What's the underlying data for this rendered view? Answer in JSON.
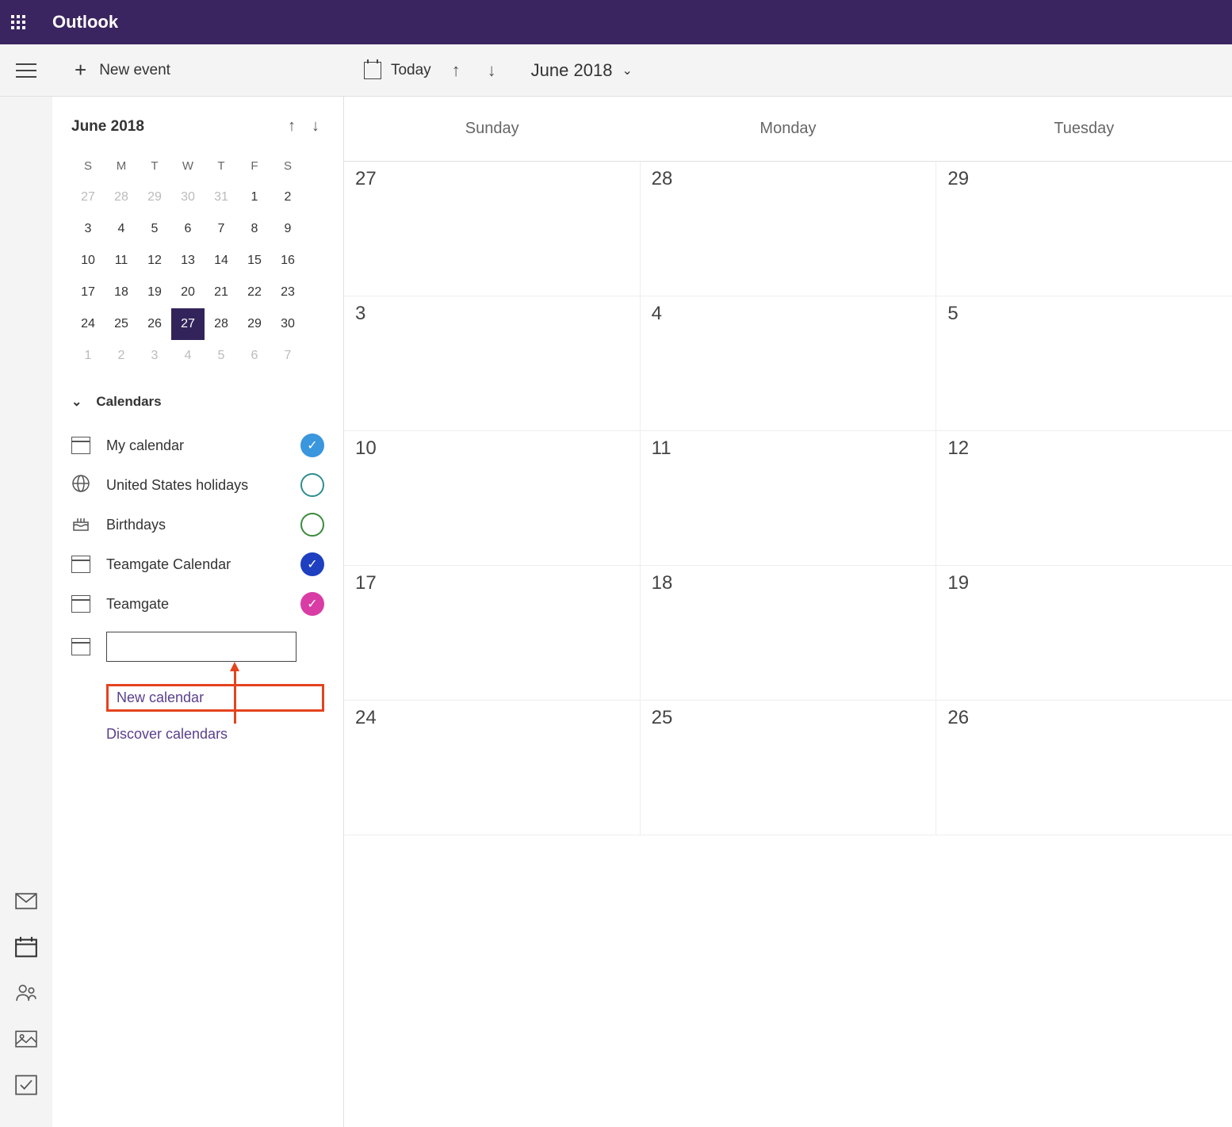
{
  "header": {
    "app_name": "Outlook"
  },
  "toolbar": {
    "new_event_label": "New event",
    "today_label": "Today",
    "current_month": "June 2018"
  },
  "sidebar": {
    "mini_month": "June 2018",
    "mini_dow": [
      "S",
      "M",
      "T",
      "W",
      "T",
      "F",
      "S"
    ],
    "mini_weeks": [
      [
        {
          "n": "27",
          "dim": true
        },
        {
          "n": "28",
          "dim": true
        },
        {
          "n": "29",
          "dim": true
        },
        {
          "n": "30",
          "dim": true
        },
        {
          "n": "31",
          "dim": true
        },
        {
          "n": "1"
        },
        {
          "n": "2"
        }
      ],
      [
        {
          "n": "3"
        },
        {
          "n": "4"
        },
        {
          "n": "5"
        },
        {
          "n": "6"
        },
        {
          "n": "7"
        },
        {
          "n": "8"
        },
        {
          "n": "9"
        }
      ],
      [
        {
          "n": "10"
        },
        {
          "n": "11"
        },
        {
          "n": "12"
        },
        {
          "n": "13"
        },
        {
          "n": "14"
        },
        {
          "n": "15"
        },
        {
          "n": "16"
        }
      ],
      [
        {
          "n": "17"
        },
        {
          "n": "18"
        },
        {
          "n": "19"
        },
        {
          "n": "20"
        },
        {
          "n": "21"
        },
        {
          "n": "22"
        },
        {
          "n": "23"
        }
      ],
      [
        {
          "n": "24"
        },
        {
          "n": "25"
        },
        {
          "n": "26"
        },
        {
          "n": "27",
          "today": true
        },
        {
          "n": "28"
        },
        {
          "n": "29"
        },
        {
          "n": "30"
        }
      ],
      [
        {
          "n": "1",
          "dim": true
        },
        {
          "n": "2",
          "dim": true
        },
        {
          "n": "3",
          "dim": true
        },
        {
          "n": "4",
          "dim": true
        },
        {
          "n": "5",
          "dim": true
        },
        {
          "n": "6",
          "dim": true
        },
        {
          "n": "7",
          "dim": true
        }
      ]
    ],
    "calendars_label": "Calendars",
    "calendars": [
      {
        "label": "My calendar",
        "toggle": "blue-check",
        "icon": "cal"
      },
      {
        "label": "United States holidays",
        "toggle": "teal-ring",
        "icon": "globe"
      },
      {
        "label": "Birthdays",
        "toggle": "green-ring",
        "icon": "cake"
      },
      {
        "label": "Teamgate Calendar",
        "toggle": "darkblue-check",
        "icon": "cal"
      },
      {
        "label": "Teamgate",
        "toggle": "pink-check",
        "icon": "cal"
      }
    ],
    "new_cal_value": "",
    "new_calendar_link": "New calendar",
    "discover_link": "Discover calendars"
  },
  "main": {
    "day_headers": [
      "Sunday",
      "Monday",
      "Tuesday"
    ],
    "weeks": [
      [
        "27",
        "28",
        "29"
      ],
      [
        "3",
        "4",
        "5"
      ],
      [
        "10",
        "11",
        "12"
      ],
      [
        "17",
        "18",
        "19"
      ],
      [
        "24",
        "25",
        "26"
      ]
    ]
  }
}
